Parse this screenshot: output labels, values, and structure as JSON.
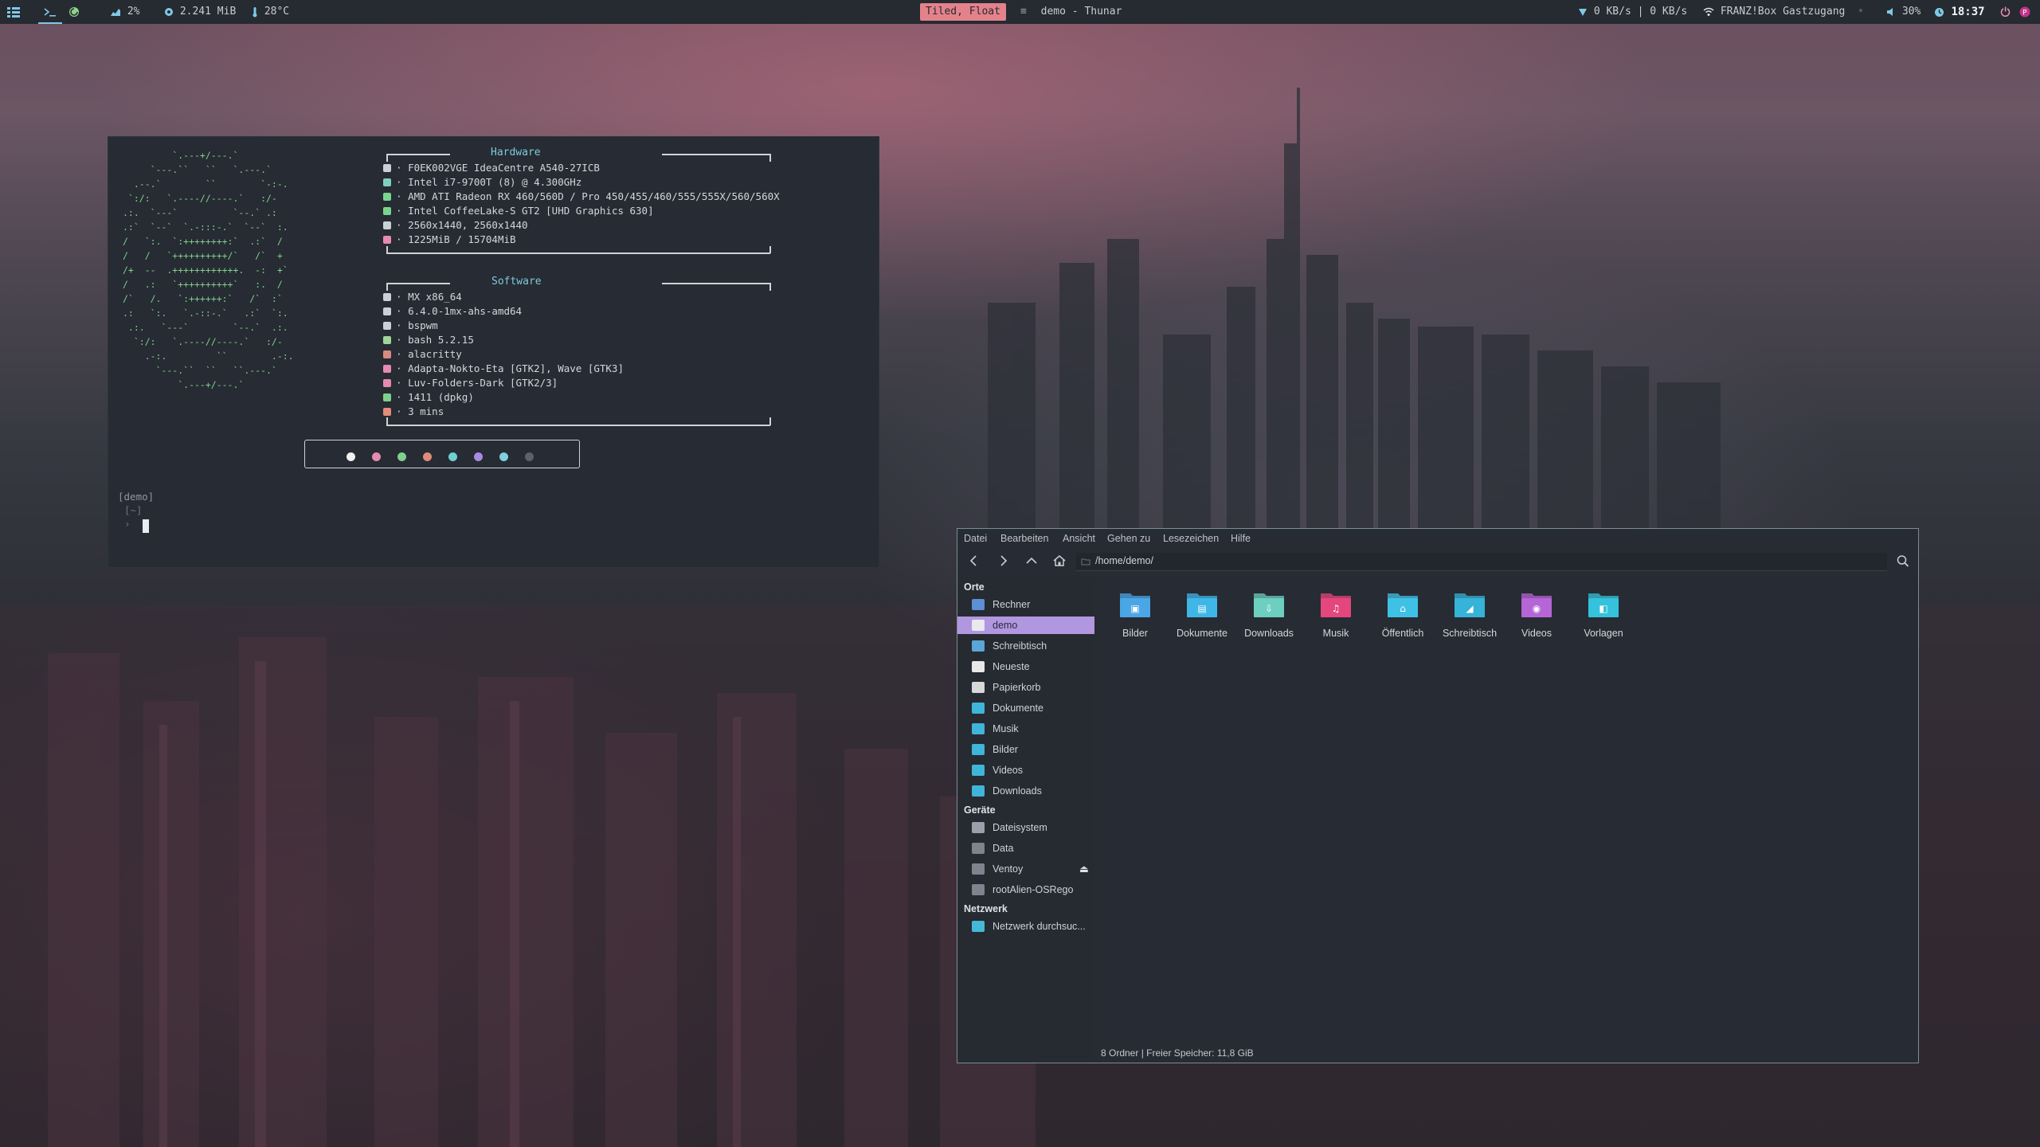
{
  "topbar": {
    "workspaces_icon": "grid-icon",
    "terminal_icon": "terminal-icon",
    "refresh_icon": "refresh-icon",
    "cpu": "2%",
    "memory": "2.241 MiB",
    "temperature": "28°C",
    "layout_mode": "Tiled, Float",
    "window_title": "demo - Thunar",
    "net_speed": "0 KB/s | 0 KB/s",
    "wifi_name": "FRANZ!Box Gastzugang",
    "volume": "30%",
    "clock": "18:37"
  },
  "terminal": {
    "ascii_logo": "         `.---+/---.`\n     `---.``   ``   `.---.`\n  .--.`        ``        `-:-.\n `:/:   `.----//----.`   :/-\n.:.  `---`          `--.` .:\n.:`  `--`  `.-:::-.`  `--`  :.\n/   `:.  `:++++++++:`  .:`  /\n/   /   `++++++++++/`   /`  +\n/+  --  .++++++++++++.  -:  +`\n/   .:   `++++++++++`   :.  /\n/`   /.   `:++++++:`   /`  :`\n.:   `:.   `.-::-.`   .:`  `:.\n .:.   `---`        `--.`  .:.\n  `:/:   `.----//----.`   :/-\n    .-:.         ``        .-:.\n      `---.``  ``   ``.---.`\n          `.---+/---.`",
    "hardware_title": "Hardware",
    "software_title": "Software",
    "hardware": [
      {
        "icon": "laptop-icon",
        "color": "#c9d0d8",
        "text": "F0EK002VGE IdeaCentre A540-27ICB"
      },
      {
        "icon": "cpu-icon",
        "color": "#7fd0bf",
        "text": "Intel i7-9700T (8) @ 4.300GHz"
      },
      {
        "icon": "gpu-icon",
        "color": "#79d48f",
        "text": "AMD ATI Radeon RX 460/560D / Pro 450/455/460/555/555X/560/560X"
      },
      {
        "icon": "gpu-icon",
        "color": "#79d48f",
        "text": "Intel CoffeeLake-S GT2 [UHD Graphics 630]"
      },
      {
        "icon": "monitor-icon",
        "color": "#c9d0d8",
        "text": "2560x1440, 2560x1440"
      },
      {
        "icon": "memory-icon",
        "color": "#e58bb0",
        "text": "1225MiB / 15704MiB"
      }
    ],
    "software": [
      {
        "icon": "os-icon",
        "color": "#c9d0d8",
        "text": "MX x86_64"
      },
      {
        "icon": "kernel-icon",
        "color": "#c9d0d8",
        "text": "6.4.0-1mx-ahs-amd64"
      },
      {
        "icon": "wm-icon",
        "color": "#c9d0d8",
        "text": "bspwm"
      },
      {
        "icon": "shell-icon",
        "color": "#9fd49a",
        "text": "bash 5.2.15"
      },
      {
        "icon": "terminal-icon",
        "color": "#d98a7f",
        "text": "alacritty"
      },
      {
        "icon": "theme-icon",
        "color": "#e58bb0",
        "text": "Adapta-Nokto-Eta [GTK2], Wave [GTK3]"
      },
      {
        "icon": "icons-icon",
        "color": "#e58bb0",
        "text": "Luv-Folders-Dark [GTK2/3]"
      },
      {
        "icon": "package-icon",
        "color": "#7fd08e",
        "text": "1411 (dpkg)"
      },
      {
        "icon": "uptime-icon",
        "color": "#e58b7a",
        "text": "3 mins"
      }
    ],
    "palette": [
      "#f2f2f2",
      "#e58bb0",
      "#7fd08e",
      "#e08c78",
      "#6fd0cf",
      "#a98ae0",
      "#7fd0e0",
      "#5c626b"
    ],
    "prompt_line1": "[demo]",
    "prompt_line2": "[~]",
    "prompt_line3": "›"
  },
  "thunar": {
    "menu": [
      "Datei",
      "Bearbeiten",
      "Ansicht",
      "Gehen zu",
      "Lesezeichen",
      "Hilfe"
    ],
    "path": "/home/demo/",
    "sidebar": {
      "places_title": "Orte",
      "places": [
        {
          "label": "Rechner",
          "icon": "computer-icon",
          "color": "#5b8fd6"
        },
        {
          "label": "demo",
          "icon": "home-icon",
          "color": "#e9e9ee",
          "active": true
        },
        {
          "label": "Schreibtisch",
          "icon": "desktop-icon",
          "color": "#5aa6d6"
        },
        {
          "label": "Neueste",
          "icon": "recent-icon",
          "color": "#e8e8e8"
        },
        {
          "label": "Papierkorb",
          "icon": "trash-icon",
          "color": "#d8d8d8"
        },
        {
          "label": "Dokumente",
          "icon": "folder-icon",
          "color": "#3fb5d9"
        },
        {
          "label": "Musik",
          "icon": "folder-icon",
          "color": "#3fb5d9"
        },
        {
          "label": "Bilder",
          "icon": "folder-icon",
          "color": "#3fb5d9"
        },
        {
          "label": "Videos",
          "icon": "folder-icon",
          "color": "#3fb5d9"
        },
        {
          "label": "Downloads",
          "icon": "folder-icon",
          "color": "#3fb5d9"
        }
      ],
      "devices_title": "Geräte",
      "devices": [
        {
          "label": "Dateisystem",
          "icon": "drive-icon",
          "color": "#9aa1ab"
        },
        {
          "label": "Data",
          "icon": "drive-icon",
          "color": "#7d848e"
        },
        {
          "label": "Ventoy",
          "icon": "drive-icon",
          "color": "#7d848e",
          "eject": true
        },
        {
          "label": "rootAlien-OSRego",
          "icon": "drive-icon",
          "color": "#7d848e"
        }
      ],
      "network_title": "Netzwerk",
      "network": [
        {
          "label": "Netzwerk durchsuc...",
          "icon": "network-icon",
          "color": "#45b8d8"
        }
      ]
    },
    "folders": [
      {
        "label": "Bilder",
        "color": "#4ba6e6",
        "glyph": "▣"
      },
      {
        "label": "Dokumente",
        "color": "#3fb6e8",
        "glyph": "▤"
      },
      {
        "label": "Downloads",
        "color": "#6ccfbf",
        "glyph": "⇩"
      },
      {
        "label": "Musik",
        "color": "#e4467e",
        "glyph": "♫"
      },
      {
        "label": "Öffentlich",
        "color": "#3fc1e6",
        "glyph": "⌂"
      },
      {
        "label": "Schreibtisch",
        "color": "#35b3d8",
        "glyph": "◢"
      },
      {
        "label": "Videos",
        "color": "#b665d6",
        "glyph": "◉"
      },
      {
        "label": "Vorlagen",
        "color": "#34c2dc",
        "glyph": "◧"
      }
    ],
    "status": "8 Ordner  |  Freier Speicher: 11,8 GiB"
  }
}
